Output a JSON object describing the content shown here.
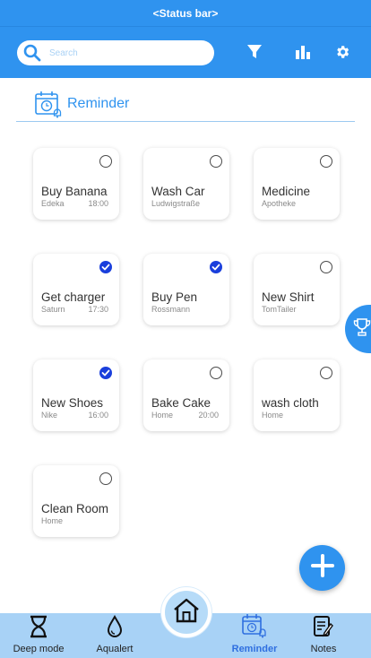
{
  "status_bar": {
    "text": "<Status bar>"
  },
  "search": {
    "placeholder": "Search"
  },
  "toolbar": {
    "filter_icon": "filter-icon",
    "stats_icon": "bar-chart-icon",
    "settings_icon": "gear-icon"
  },
  "section": {
    "title": "Reminder",
    "icon": "calendar-clock-bell-icon"
  },
  "reminders": [
    {
      "title": "Buy Banana",
      "subtitle": "Edeka",
      "time": "18:00",
      "checked": false
    },
    {
      "title": "Wash Car",
      "subtitle": "Ludwigstraße",
      "time": "",
      "checked": false
    },
    {
      "title": "Medicine",
      "subtitle": "Apotheke",
      "time": "",
      "checked": false
    },
    {
      "title": "Get charger",
      "subtitle": "Saturn",
      "time": "17:30",
      "checked": true
    },
    {
      "title": "Buy Pen",
      "subtitle": "Rossmann",
      "time": "",
      "checked": true
    },
    {
      "title": "New Shirt",
      "subtitle": "TomTailer",
      "time": "",
      "checked": false
    },
    {
      "title": "New Shoes",
      "subtitle": "Nike",
      "time": "16:00",
      "checked": true
    },
    {
      "title": "Bake Cake",
      "subtitle": "Home",
      "time": "20:00",
      "checked": false
    },
    {
      "title": "wash cloth",
      "subtitle": "Home",
      "time": "",
      "checked": false
    },
    {
      "title": "Clean Room",
      "subtitle": "Home",
      "time": "",
      "checked": false
    }
  ],
  "nav": {
    "items": [
      {
        "label": "Deep mode",
        "icon": "hourglass-icon",
        "active": false
      },
      {
        "label": "Aqualert",
        "icon": "water-drop-icon",
        "active": false
      },
      {
        "label": "Reminder",
        "icon": "reminder-icon",
        "active": true
      },
      {
        "label": "Notes",
        "icon": "notes-icon",
        "active": false
      }
    ],
    "home_icon": "home-icon"
  },
  "colors": {
    "primary": "#2f93ef",
    "nav_bg": "#a8d2f6",
    "check": "#1a3fdc"
  }
}
